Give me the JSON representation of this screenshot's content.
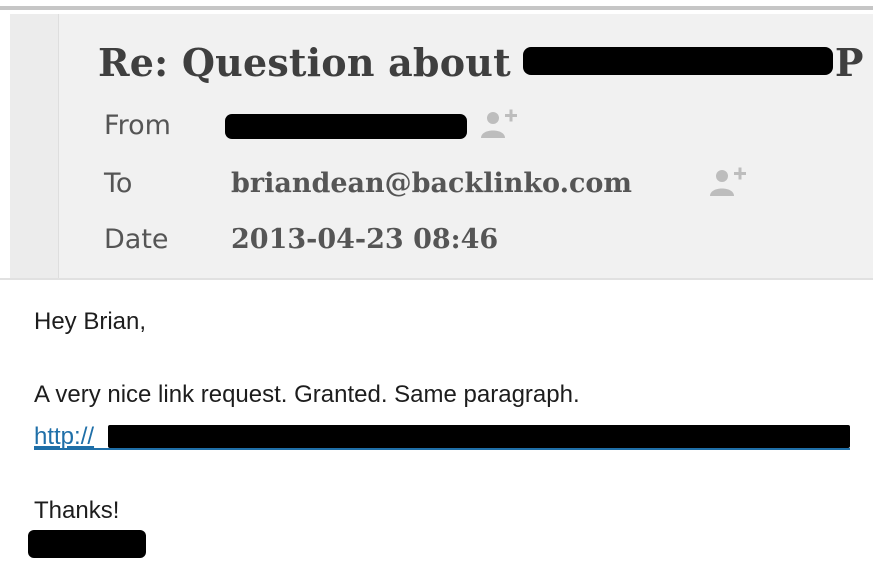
{
  "email": {
    "subject_prefix": "Re: Question about",
    "subject_tail": "P",
    "header": {
      "from_label": "From",
      "to_label": "To",
      "to_value": "briandean@backlinko.com",
      "date_label": "Date",
      "date_value": "2013-04-23 08:46"
    },
    "body": {
      "greeting": "Hey Brian,",
      "line1": "A very nice link request. Granted. Same paragraph.",
      "link_prefix": "http://",
      "closing": "Thanks!"
    }
  },
  "icons": {
    "add_contact": "person-plus-icon"
  },
  "colors": {
    "header_bg": "#f1f1f1",
    "header_text": "#555555",
    "subject_text": "#3f3f3f",
    "link": "#1f6fa8",
    "redaction": "#000000"
  }
}
